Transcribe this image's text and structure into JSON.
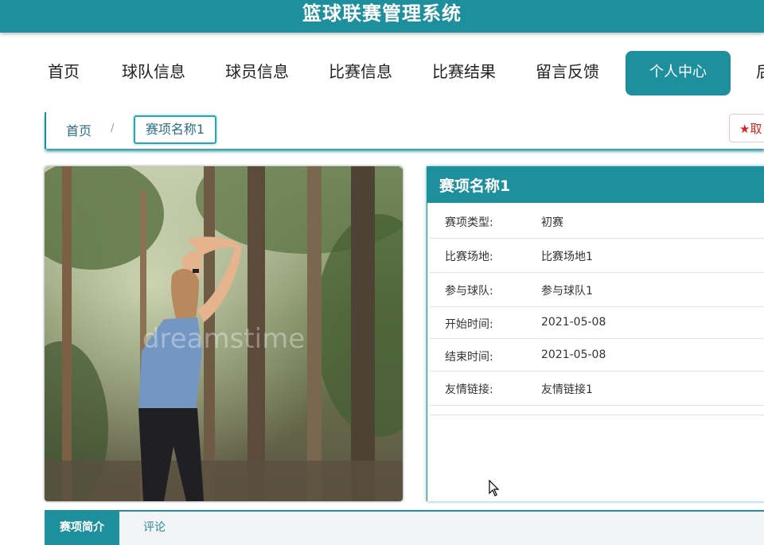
{
  "app": {
    "title": "篮球联赛管理系统"
  },
  "nav": {
    "items": [
      {
        "label": "首页"
      },
      {
        "label": "球队信息"
      },
      {
        "label": "球员信息"
      },
      {
        "label": "比赛信息"
      },
      {
        "label": "比赛结果"
      },
      {
        "label": "留言反馈"
      },
      {
        "label": "个人中心"
      },
      {
        "label": "后"
      }
    ],
    "active": "个人中心"
  },
  "breadcrumb": {
    "home": "首页",
    "separator": "/",
    "current": "赛项名称1"
  },
  "collect_button": {
    "icon": "star-icon",
    "label": "取"
  },
  "detail": {
    "title": "赛项名称1",
    "rows": [
      {
        "label": "赛项类型:",
        "value": "初赛"
      },
      {
        "label": "比赛场地:",
        "value": "比赛场地1"
      },
      {
        "label": "参与球队:",
        "value": "参与球队1"
      },
      {
        "label": "开始时间:",
        "value": "2021-05-08"
      },
      {
        "label": "结束时间:",
        "value": "2021-05-08"
      },
      {
        "label": "友情链接:",
        "value": "友情链接1"
      }
    ]
  },
  "image": {
    "watermark": "dreamstime"
  },
  "tabs": [
    {
      "label": "赛项简介"
    },
    {
      "label": "评论"
    }
  ],
  "colors": {
    "primary": "#1e8f9c",
    "link": "#2a6f86",
    "star": "#dd2222"
  }
}
